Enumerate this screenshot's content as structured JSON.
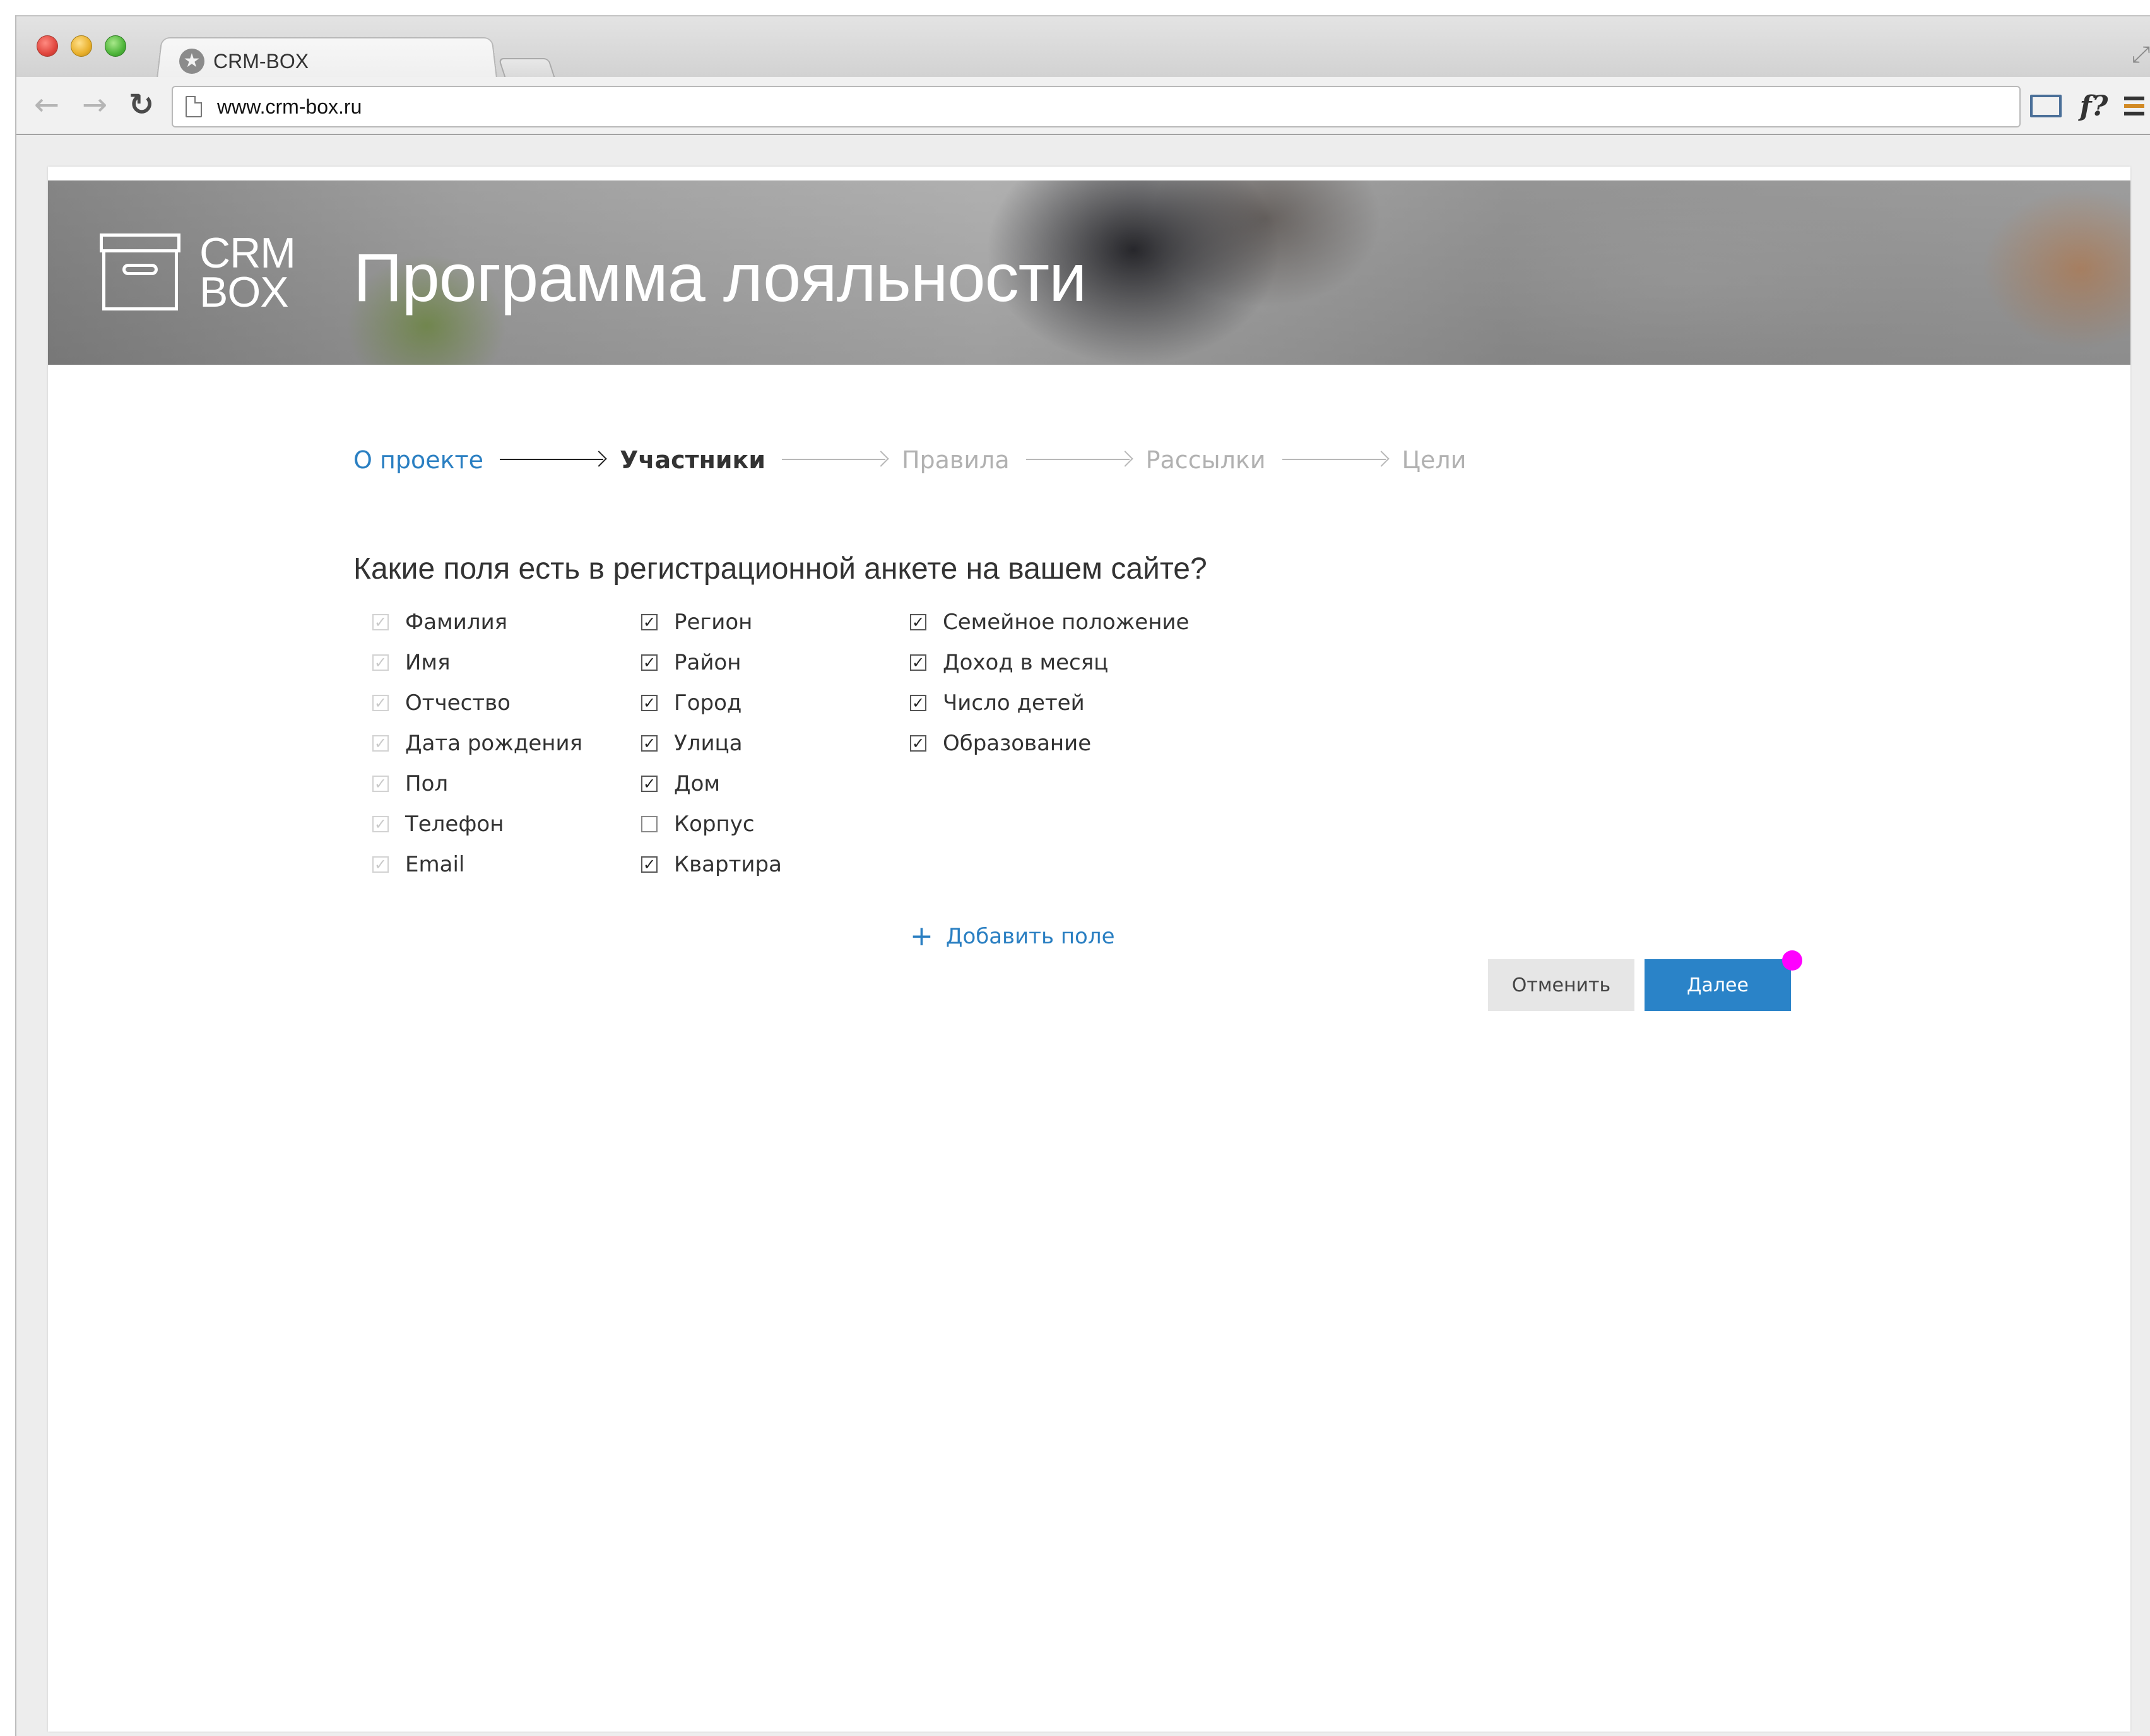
{
  "browser": {
    "tab_title": "CRM-BOX",
    "url": "www.crm-box.ru",
    "toolbar_fx_label": "f?"
  },
  "header": {
    "logo_line1": "CRM",
    "logo_line2": "BOX",
    "title": "Программа лояльности"
  },
  "stepper": {
    "steps": [
      {
        "label": "О проекте",
        "state": "done"
      },
      {
        "label": "Участники",
        "state": "active"
      },
      {
        "label": "Правила",
        "state": "todo"
      },
      {
        "label": "Рассылки",
        "state": "todo"
      },
      {
        "label": "Цели",
        "state": "todo"
      }
    ]
  },
  "form": {
    "question": "Какие поля есть в регистрационной анкете на вашем сайте?",
    "columns": [
      [
        {
          "label": "Фамилия",
          "checked": true,
          "disabled": true
        },
        {
          "label": "Имя",
          "checked": true,
          "disabled": true
        },
        {
          "label": "Отчество",
          "checked": true,
          "disabled": true
        },
        {
          "label": "Дата рождения",
          "checked": true,
          "disabled": true
        },
        {
          "label": "Пол",
          "checked": true,
          "disabled": true
        },
        {
          "label": "Телефон",
          "checked": true,
          "disabled": true
        },
        {
          "label": "Email",
          "checked": true,
          "disabled": true
        }
      ],
      [
        {
          "label": "Регион",
          "checked": true,
          "disabled": false
        },
        {
          "label": "Район",
          "checked": true,
          "disabled": false
        },
        {
          "label": "Город",
          "checked": true,
          "disabled": false
        },
        {
          "label": "Улица",
          "checked": true,
          "disabled": false
        },
        {
          "label": "Дом",
          "checked": true,
          "disabled": false
        },
        {
          "label": "Корпус",
          "checked": false,
          "disabled": false
        },
        {
          "label": "Квартира",
          "checked": true,
          "disabled": false
        }
      ],
      [
        {
          "label": "Семейное положение",
          "checked": true,
          "disabled": false
        },
        {
          "label": "Доход в месяц",
          "checked": true,
          "disabled": false
        },
        {
          "label": "Число детей",
          "checked": true,
          "disabled": false
        },
        {
          "label": "Образование",
          "checked": true,
          "disabled": false
        }
      ]
    ],
    "add_field_label": "Добавить поле"
  },
  "actions": {
    "cancel_label": "Отменить",
    "next_label": "Далее"
  },
  "colors": {
    "accent": "#2a83c8",
    "link": "#2a7fc2",
    "cursor_marker": "#ff00ff"
  }
}
